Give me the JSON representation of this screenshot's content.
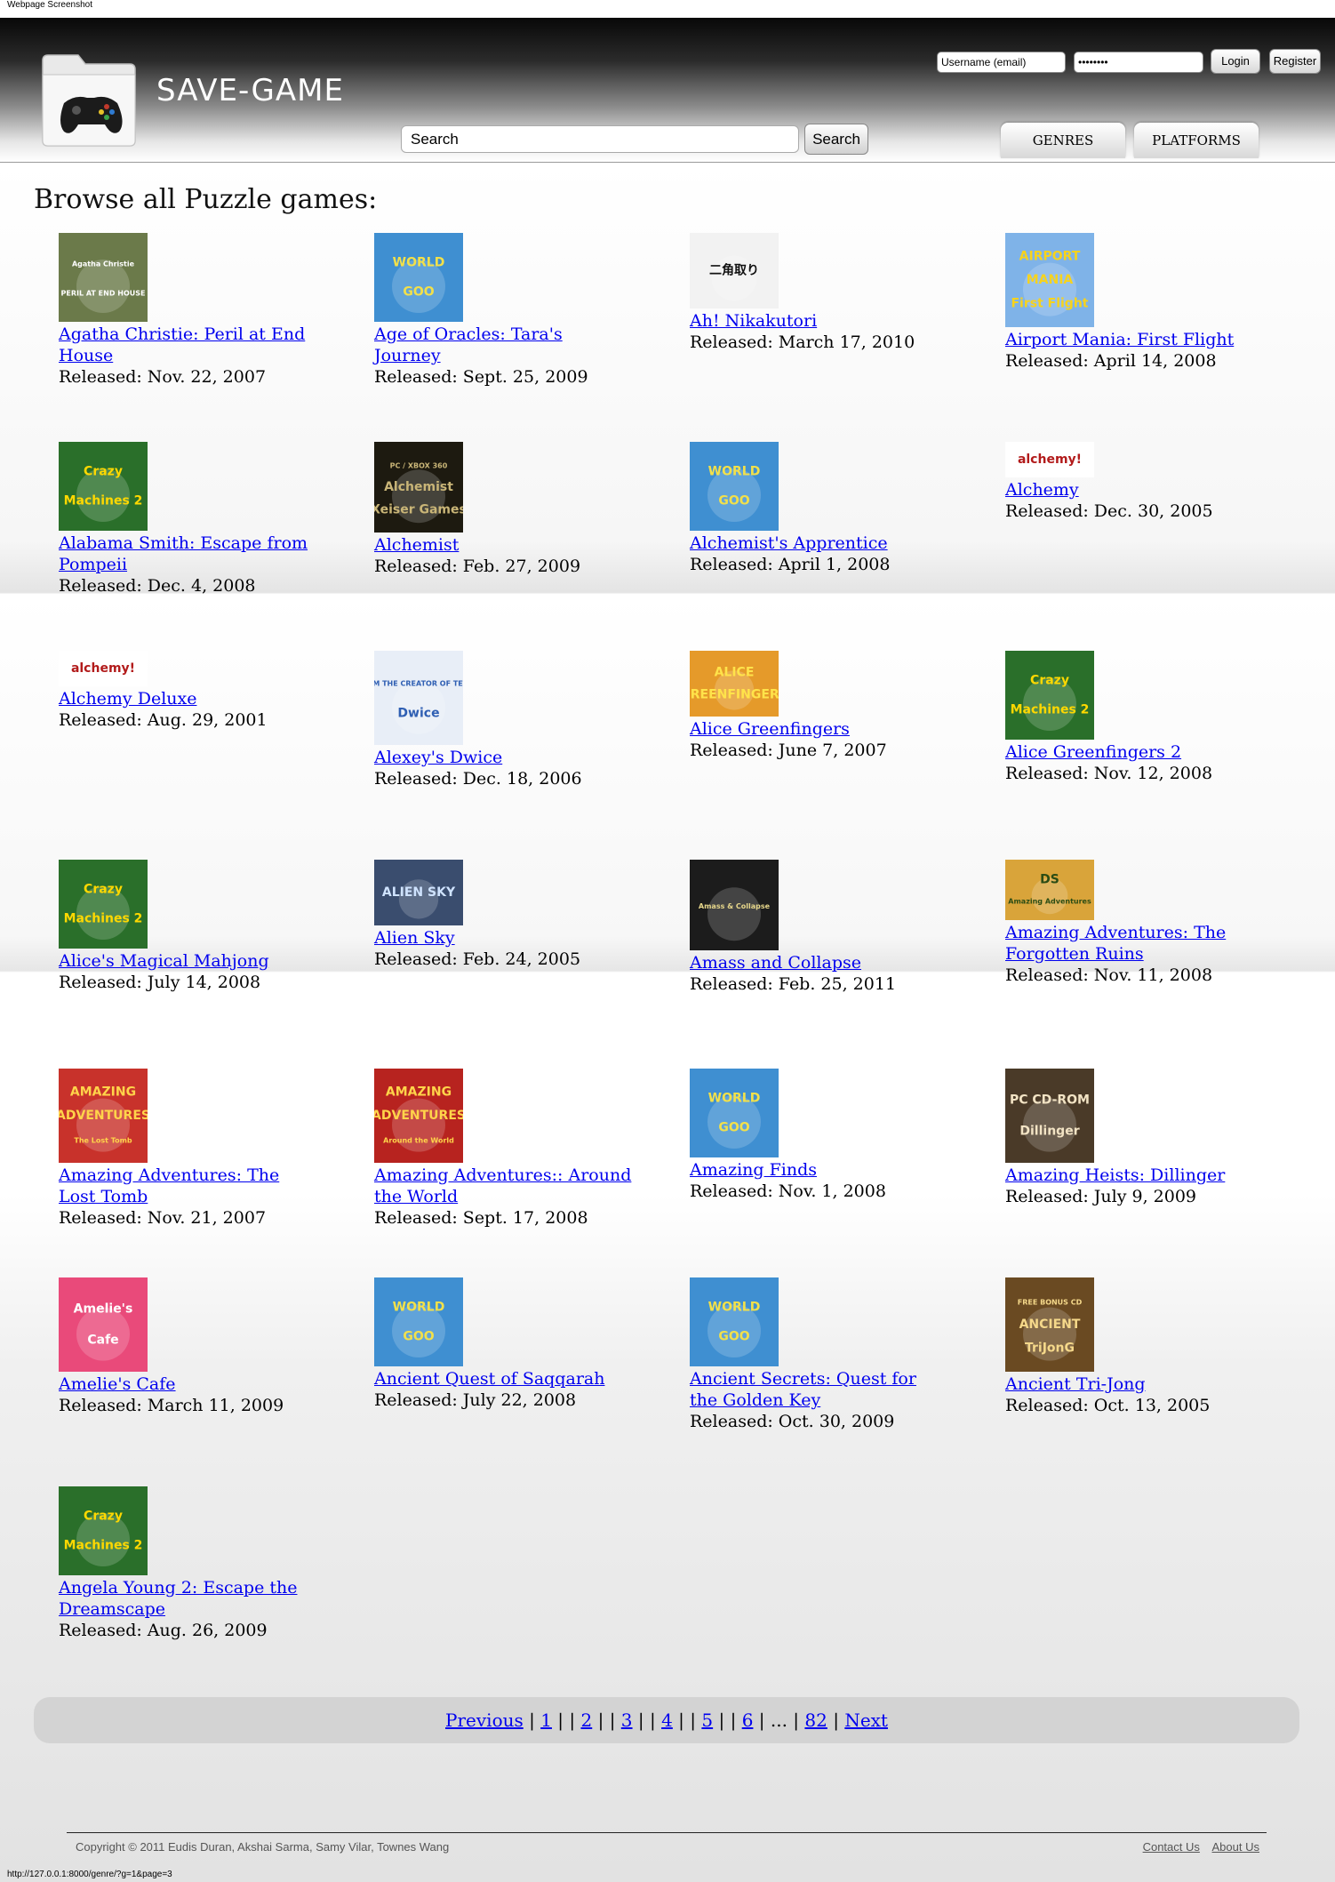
{
  "screenshot_label": "Webpage Screenshot",
  "site": {
    "title": "SAVE-GAME",
    "login": {
      "username_value": "Username (email)",
      "password_value": "••••••••",
      "login_label": "Login",
      "register_label": "Register"
    },
    "search": {
      "value": "Search",
      "button_label": "Search"
    },
    "nav": [
      "GENRES",
      "PLATFORMS"
    ]
  },
  "page": {
    "heading": "Browse all Puzzle games:"
  },
  "games": [
    {
      "title": "Agatha Christie: Peril at End House",
      "released": "Released: Nov. 22, 2007",
      "cover": "agatha"
    },
    {
      "title": "Age of Oracles: Tara's Journey",
      "released": "Released: Sept. 25, 2009",
      "cover": "worldgoo"
    },
    {
      "title": "Ah! Nikakutori",
      "released": "Released: March 17, 2010",
      "cover": "nikakutori"
    },
    {
      "title": "Airport Mania: First Flight",
      "released": "Released: April 14, 2008",
      "cover": "airport"
    },
    {
      "title": "Alabama Smith: Escape from Pompeii",
      "released": "Released: Dec. 4, 2008",
      "cover": "crazy"
    },
    {
      "title": "Alchemist",
      "released": "Released: Feb. 27, 2009",
      "cover": "alchemist"
    },
    {
      "title": "Alchemist's Apprentice",
      "released": "Released: April 1, 2008",
      "cover": "worldgoo"
    },
    {
      "title": "Alchemy",
      "released": "Released: Dec. 30, 2005",
      "cover": "alchemy"
    },
    {
      "title": "Alchemy Deluxe",
      "released": "Released: Aug. 29, 2001",
      "cover": "alchemy"
    },
    {
      "title": "Alexey's Dwice",
      "released": "Released: Dec. 18, 2006",
      "cover": "dwice"
    },
    {
      "title": "Alice Greenfingers",
      "released": "Released: June 7, 2007",
      "cover": "alice"
    },
    {
      "title": "Alice Greenfingers 2",
      "released": "Released: Nov. 12, 2008",
      "cover": "crazy"
    },
    {
      "title": "Alice's Magical Mahjong",
      "released": "Released: July 14, 2008",
      "cover": "crazy"
    },
    {
      "title": "Alien Sky",
      "released": "Released: Feb. 24, 2005",
      "cover": "aliensky"
    },
    {
      "title": "Amass and Collapse",
      "released": "Released: Feb. 25, 2011",
      "cover": "amass"
    },
    {
      "title": "Amazing Adventures: The Forgotten Ruins",
      "released": "Released: Nov. 11, 2008",
      "cover": "forgotten"
    },
    {
      "title": "Amazing Adventures: The Lost Tomb",
      "released": "Released: Nov. 21, 2007",
      "cover": "losttomb"
    },
    {
      "title": "Amazing Adventures:: Around the World",
      "released": "Released: Sept. 17, 2008",
      "cover": "aroundworld"
    },
    {
      "title": "Amazing Finds",
      "released": "Released: Nov. 1, 2008",
      "cover": "worldgoo"
    },
    {
      "title": "Amazing Heists: Dillinger",
      "released": "Released: July 9, 2009",
      "cover": "dillinger"
    },
    {
      "title": "Amelie's Cafe",
      "released": "Released: March 11, 2009",
      "cover": "amelie"
    },
    {
      "title": "Ancient Quest of Saqqarah",
      "released": "Released: July 22, 2008",
      "cover": "worldgoo"
    },
    {
      "title": "Ancient Secrets: Quest for the Golden Key",
      "released": "Released: Oct. 30, 2009",
      "cover": "worldgoo"
    },
    {
      "title": "Ancient Tri-Jong",
      "released": "Released: Oct. 13, 2005",
      "cover": "trijong"
    },
    {
      "title": "Angela Young 2: Escape the Dreamscape",
      "released": "Released: Aug. 26, 2009",
      "cover": "crazy"
    }
  ],
  "cover_art": {
    "agatha": {
      "lines": [
        "Agatha Christie",
        "PERIL AT END HOUSE"
      ],
      "bg": "#6b7a4a",
      "fg": "#ffffff",
      "h": 100
    },
    "worldgoo": {
      "lines": [
        "WORLD",
        "GOO"
      ],
      "bg": "#3f8fd1",
      "fg": "#f2e04a",
      "h": 100
    },
    "nikakutori": {
      "lines": [
        "二角取り"
      ],
      "bg": "#f2f2f2",
      "fg": "#111111",
      "h": 85
    },
    "airport": {
      "lines": [
        "AIRPORT",
        "MANIA",
        "First Flight"
      ],
      "bg": "#7fb3e8",
      "fg": "#f7d31c",
      "h": 106
    },
    "crazy": {
      "lines": [
        "Crazy",
        "Machines 2"
      ],
      "bg": "#2a6f2a",
      "fg": "#ffd800",
      "h": 100
    },
    "alchemist": {
      "lines": [
        "PC / XBOX 360",
        "Alchemist",
        "Xeiser Games"
      ],
      "bg": "#1d1a10",
      "fg": "#c9b577",
      "h": 102
    },
    "alchemy": {
      "lines": [
        "alchemy!"
      ],
      "bg": "#ffffff",
      "fg": "#b21b1b",
      "h": 40
    },
    "dwice": {
      "lines": [
        "FROM THE CREATOR OF TETRIS",
        "Dwice"
      ],
      "bg": "#e8eef7",
      "fg": "#2f5fb3",
      "h": 106
    },
    "alice": {
      "lines": [
        "ALICE",
        "GREENFINGERS"
      ],
      "bg": "#e59a2a",
      "fg": "#ffe34a",
      "h": 74
    },
    "aliensky": {
      "lines": [
        "ALIEN SKY"
      ],
      "bg": "#3a4d6e",
      "fg": "#cfe3ff",
      "h": 74
    },
    "amass": {
      "lines": [
        "Amass & Collapse"
      ],
      "bg": "#1c1c1c",
      "fg": "#e6d68a",
      "h": 102
    },
    "forgotten": {
      "lines": [
        "DS",
        "Amazing Adventures"
      ],
      "bg": "#d9a43a",
      "fg": "#2b4c14",
      "h": 68
    },
    "losttomb": {
      "lines": [
        "AMAZING",
        "ADVENTURES",
        "The Lost Tomb"
      ],
      "bg": "#c8322b",
      "fg": "#ffd44a",
      "h": 106
    },
    "aroundworld": {
      "lines": [
        "AMAZING",
        "ADVENTURES",
        "Around the World"
      ],
      "bg": "#b7231f",
      "fg": "#ffd44a",
      "h": 106
    },
    "dillinger": {
      "lines": [
        "PC CD-ROM",
        "Dillinger"
      ],
      "bg": "#4a3a28",
      "fg": "#f2e3c4",
      "h": 106
    },
    "amelie": {
      "lines": [
        "Amelie's",
        "Cafe"
      ],
      "bg": "#e94a7a",
      "fg": "#ffffff",
      "h": 106
    },
    "trijong": {
      "lines": [
        "FREE BONUS CD",
        "ANCIENT",
        "TriJonG"
      ],
      "bg": "#6a4a22",
      "fg": "#f5d88a",
      "h": 106
    }
  },
  "pagination": {
    "previous": "Previous",
    "pages": [
      "1",
      "2",
      "3",
      "4",
      "5",
      "6"
    ],
    "ellipsis": "...",
    "last": "82",
    "next": "Next"
  },
  "footer": {
    "copyright": "Copyright © 2011 Eudis Duran, Akshai Sarma, Samy Vilar, Townes Wang",
    "links": [
      "Contact Us",
      "About Us"
    ]
  },
  "status_url": "http://127.0.0.1:8000/genre/?g=1&page=3",
  "colors": {
    "link": "#0000ee",
    "header_dark": "#0b0b0b",
    "pagination_bar": "#d3d3d3"
  }
}
